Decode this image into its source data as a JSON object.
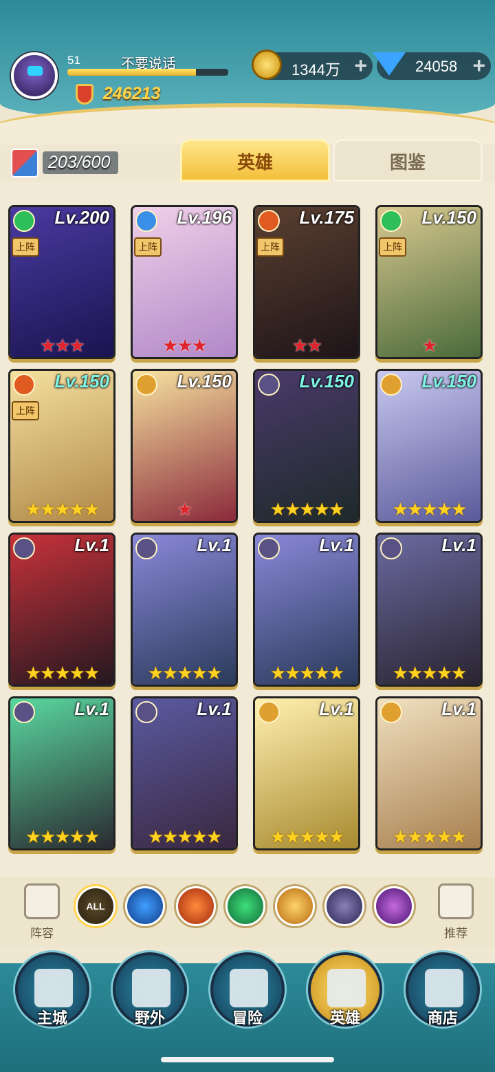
{
  "player": {
    "level": "51",
    "name": "不要说话",
    "xp_fraction": 0.8,
    "power": "246213"
  },
  "resources": {
    "gold": "1344万",
    "gems": "24058",
    "plus": "+"
  },
  "inventory": {
    "hero_count": "203/600"
  },
  "tabs": {
    "heroes": "英雄",
    "codex": "图鉴"
  },
  "deploy_label": "上阵",
  "filters": [
    "ALL"
  ],
  "side": {
    "lineup": "阵容",
    "recommend": "推荐"
  },
  "nav": {
    "city": "主城",
    "wild": "野外",
    "adventure": "冒险",
    "heroes": "英雄",
    "shop": "商店"
  },
  "heroes": [
    {
      "lv": "Lv.200",
      "stars": "★★★",
      "star_color": "red",
      "deployed": true,
      "element": "wind"
    },
    {
      "lv": "Lv.196",
      "stars": "★★★",
      "star_color": "red",
      "deployed": true,
      "element": "water"
    },
    {
      "lv": "Lv.175",
      "stars": "★★",
      "star_color": "red",
      "deployed": true,
      "element": "fire"
    },
    {
      "lv": "Lv.150",
      "stars": "★",
      "star_color": "red",
      "deployed": true,
      "element": "wind"
    },
    {
      "lv": "Lv.150",
      "stars": "★★★★★",
      "star_color": "gold",
      "deployed": true,
      "element": "fire"
    },
    {
      "lv": "Lv.150",
      "stars": "★",
      "star_color": "red",
      "deployed": false,
      "element": "light"
    },
    {
      "lv": "Lv.150",
      "stars": "★★★★★",
      "star_color": "gold",
      "deployed": false,
      "element": "dark"
    },
    {
      "lv": "Lv.150",
      "stars": "★★★★★",
      "star_color": "gold",
      "deployed": false,
      "element": "light"
    },
    {
      "lv": "Lv.1",
      "stars": "★★★★★",
      "star_color": "gold",
      "deployed": false,
      "element": "dark"
    },
    {
      "lv": "Lv.1",
      "stars": "★★★★★",
      "star_color": "gold",
      "deployed": false,
      "element": "dark"
    },
    {
      "lv": "Lv.1",
      "stars": "★★★★★",
      "star_color": "gold",
      "deployed": false,
      "element": "dark"
    },
    {
      "lv": "Lv.1",
      "stars": "★★★★★",
      "star_color": "gold",
      "deployed": false,
      "element": "dark"
    },
    {
      "lv": "Lv.1",
      "stars": "★★★★★",
      "star_color": "gold",
      "deployed": false,
      "element": "dark"
    },
    {
      "lv": "Lv.1",
      "stars": "★★★★★",
      "star_color": "gold",
      "deployed": false,
      "element": "dark"
    },
    {
      "lv": "Lv.1",
      "stars": "★★★★★",
      "star_color": "gold",
      "deployed": false,
      "element": "light"
    },
    {
      "lv": "Lv.1",
      "stars": "★★★★★",
      "star_color": "gold",
      "deployed": false,
      "element": "light"
    }
  ],
  "colors": {
    "teal": "#2c8a98",
    "gold": "#f3bf3a"
  }
}
